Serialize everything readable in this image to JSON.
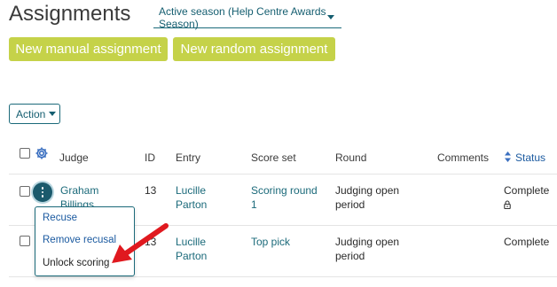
{
  "page_title": "Assignments",
  "season_select": {
    "value": "Active season (Help Centre Awards Season)"
  },
  "buttons": {
    "new_manual": "New manual assignment",
    "new_random": "New random assignment",
    "action": "Action"
  },
  "table": {
    "columns": [
      "Judge",
      "ID",
      "Entry",
      "Score set",
      "Round",
      "Comments",
      "Status"
    ],
    "sort_column": "Status",
    "rows": [
      {
        "judge_line1": "Graham",
        "judge_line2": "Billings",
        "id": "13",
        "entry_line1": "Lucille",
        "entry_line2": "Parton",
        "score_set_line1": "Scoring round",
        "score_set_line2": "1",
        "round_line1": "Judging open",
        "round_line2": "period",
        "comments": "",
        "status": "Complete",
        "status_icon": "lock-icon"
      },
      {
        "judge_line1": "",
        "judge_line2": "",
        "id": "13",
        "entry_line1": "Lucille",
        "entry_line2": "Parton",
        "score_set_line1": "Top pick",
        "score_set_line2": "",
        "round_line1": "Judging open",
        "round_line2": "period",
        "comments": "",
        "status": "Complete"
      }
    ]
  },
  "row_menu": {
    "items": [
      "Recuse",
      "Remove recusal",
      "Unlock scoring"
    ]
  },
  "colors": {
    "accent": "#1b6a7a",
    "green_button": "#c5d249",
    "arrow": "#e0191f"
  }
}
